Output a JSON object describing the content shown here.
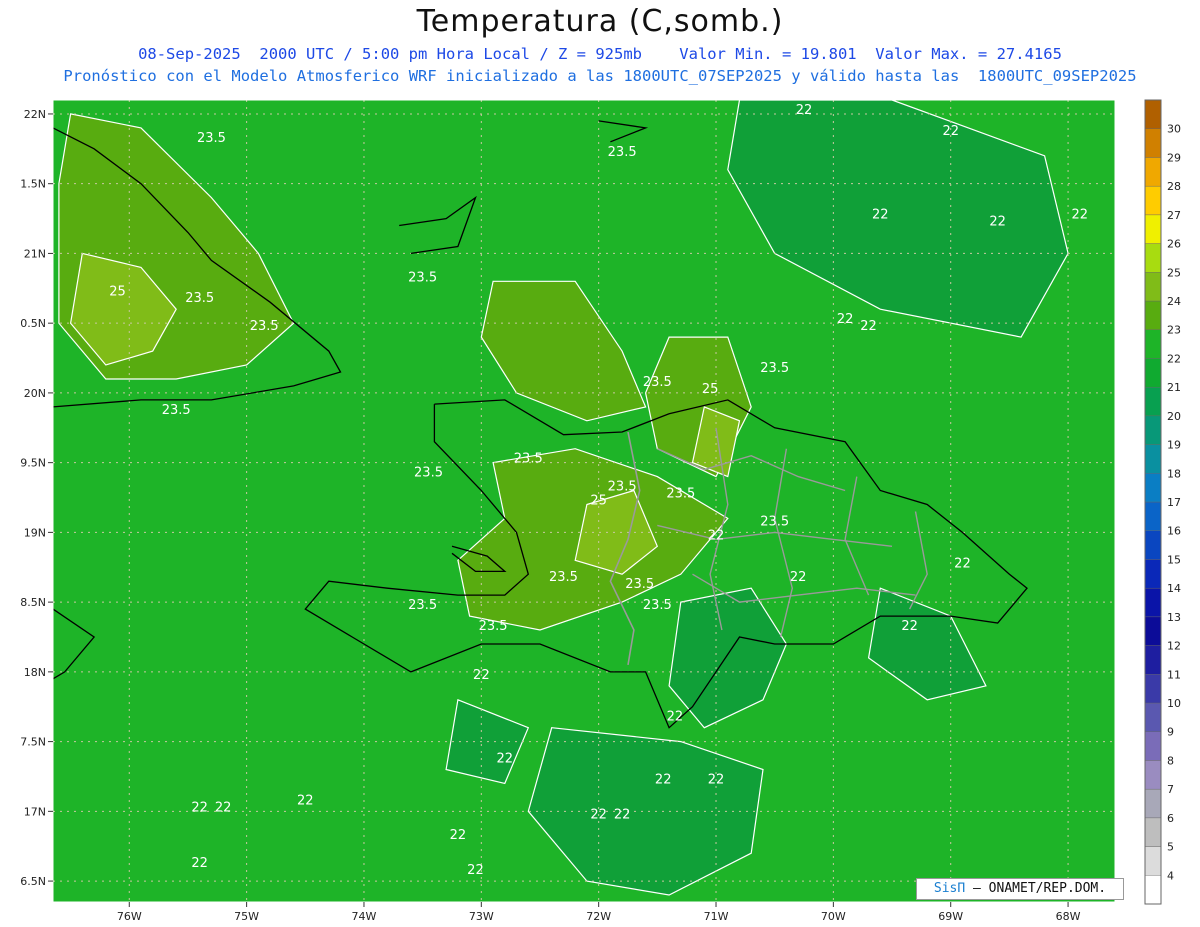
{
  "title": "Temperatura (C,somb.)",
  "subtitle_line1": "08-Sep-2025  2000 UTC / 5:00 pm Hora Local / Z = 925mb    Valor Min. = 19.801  Valor Max. = 27.4165",
  "subtitle_line2": "Pronóstico con el Modelo Atmosferico WRF inicializado a las 1800UTC_07SEP2025 y válido hasta las  1800UTC_09SEP2025",
  "credit": {
    "brand": "SisΠ",
    "text": " – ONAMET/REP.DOM."
  },
  "map": {
    "lon_range": [
      -76.65,
      -67.6
    ],
    "lat_range": [
      16.35,
      22.1
    ],
    "lat_ticks": [
      {
        "value": 22.0,
        "label": "22N"
      },
      {
        "value": 21.5,
        "label": "1.5N"
      },
      {
        "value": 21.0,
        "label": "21N"
      },
      {
        "value": 20.5,
        "label": "0.5N"
      },
      {
        "value": 20.0,
        "label": "20N"
      },
      {
        "value": 19.5,
        "label": "9.5N"
      },
      {
        "value": 19.0,
        "label": "19N"
      },
      {
        "value": 18.5,
        "label": "8.5N"
      },
      {
        "value": 18.0,
        "label": "18N"
      },
      {
        "value": 17.5,
        "label": "7.5N"
      },
      {
        "value": 17.0,
        "label": "17N"
      },
      {
        "value": 16.5,
        "label": "6.5N"
      }
    ],
    "lon_ticks": [
      {
        "value": -76,
        "label": "76W"
      },
      {
        "value": -75,
        "label": "75W"
      },
      {
        "value": -74,
        "label": "74W"
      },
      {
        "value": -73,
        "label": "73W"
      },
      {
        "value": -72,
        "label": "72W"
      },
      {
        "value": -71,
        "label": "71W"
      },
      {
        "value": -70,
        "label": "70W"
      },
      {
        "value": -69,
        "label": "69W"
      },
      {
        "value": -68,
        "label": "68W"
      }
    ],
    "base_color": "#1eb428",
    "colorbar": {
      "levels": [
        4,
        5,
        6,
        7,
        8,
        9,
        10,
        11,
        12,
        13,
        14,
        15,
        16,
        17,
        18,
        19,
        20,
        21,
        22,
        23,
        24,
        25,
        26,
        27,
        28,
        29,
        30
      ],
      "colors": [
        "#ffffff",
        "#dcdcdc",
        "#bebebe",
        "#a8a8b8",
        "#9a8cc0",
        "#7a6cb8",
        "#5a58b0",
        "#3a3aa8",
        "#1e1ea0",
        "#0c0c98",
        "#0a14a8",
        "#0a28b8",
        "#0a46c0",
        "#0a64c8",
        "#0a7ec4",
        "#0a90a0",
        "#089878",
        "#08a050",
        "#10aa30",
        "#1eb428",
        "#58ac10",
        "#80bc18",
        "#a8dc10",
        "#f0f000",
        "#ffcc00",
        "#f0a800",
        "#d08000",
        "#b06000"
      ]
    },
    "contour_labels": [
      "22",
      "23.5",
      "25"
    ],
    "regions": [
      {
        "level": "22",
        "color": "#10a038",
        "pts": [
          [
            -70.8,
            22.1
          ],
          [
            -69.5,
            22.1
          ],
          [
            -68.2,
            21.7
          ],
          [
            -68.0,
            21.0
          ],
          [
            -68.4,
            20.4
          ],
          [
            -69.6,
            20.6
          ],
          [
            -70.5,
            21.0
          ],
          [
            -70.9,
            21.6
          ]
        ]
      },
      {
        "level": "22",
        "color": "#10a038",
        "pts": [
          [
            -72.4,
            17.6
          ],
          [
            -71.3,
            17.5
          ],
          [
            -70.6,
            17.3
          ],
          [
            -70.7,
            16.7
          ],
          [
            -71.4,
            16.4
          ],
          [
            -72.1,
            16.5
          ],
          [
            -72.6,
            17.0
          ]
        ]
      },
      {
        "level": "22",
        "color": "#10a038",
        "pts": [
          [
            -71.3,
            18.5
          ],
          [
            -70.7,
            18.6
          ],
          [
            -70.4,
            18.2
          ],
          [
            -70.6,
            17.8
          ],
          [
            -71.1,
            17.6
          ],
          [
            -71.4,
            17.9
          ]
        ]
      },
      {
        "level": "22",
        "color": "#10a038",
        "pts": [
          [
            -73.2,
            17.8
          ],
          [
            -72.6,
            17.6
          ],
          [
            -72.8,
            17.2
          ],
          [
            -73.3,
            17.3
          ]
        ]
      },
      {
        "level": "22",
        "color": "#10a038",
        "pts": [
          [
            -69.6,
            18.6
          ],
          [
            -69.0,
            18.4
          ],
          [
            -68.7,
            17.9
          ],
          [
            -69.2,
            17.8
          ],
          [
            -69.7,
            18.1
          ]
        ]
      },
      {
        "level": "23.5",
        "color": "#58ac10",
        "pts": [
          [
            -76.5,
            22.0
          ],
          [
            -75.9,
            21.9
          ],
          [
            -75.3,
            21.4
          ],
          [
            -74.9,
            21.0
          ],
          [
            -74.6,
            20.5
          ],
          [
            -75.0,
            20.2
          ],
          [
            -75.6,
            20.1
          ],
          [
            -76.2,
            20.1
          ],
          [
            -76.6,
            20.5
          ],
          [
            -76.6,
            21.5
          ]
        ]
      },
      {
        "level": "23.5",
        "color": "#58ac10",
        "pts": [
          [
            -72.9,
            20.8
          ],
          [
            -72.2,
            20.8
          ],
          [
            -71.8,
            20.3
          ],
          [
            -71.6,
            19.9
          ],
          [
            -72.1,
            19.8
          ],
          [
            -72.7,
            20.0
          ],
          [
            -73.0,
            20.4
          ]
        ]
      },
      {
        "level": "23.5",
        "color": "#58ac10",
        "pts": [
          [
            -71.4,
            20.4
          ],
          [
            -70.9,
            20.4
          ],
          [
            -70.7,
            19.9
          ],
          [
            -71.0,
            19.4
          ],
          [
            -71.5,
            19.6
          ],
          [
            -71.6,
            20.0
          ]
        ]
      },
      {
        "level": "23.5",
        "color": "#58ac10",
        "pts": [
          [
            -72.9,
            19.5
          ],
          [
            -72.2,
            19.6
          ],
          [
            -71.5,
            19.4
          ],
          [
            -70.9,
            19.1
          ],
          [
            -71.3,
            18.7
          ],
          [
            -71.8,
            18.5
          ],
          [
            -72.5,
            18.3
          ],
          [
            -73.1,
            18.4
          ],
          [
            -73.2,
            18.8
          ],
          [
            -72.8,
            19.1
          ]
        ]
      },
      {
        "level": "25",
        "color": "#80bc18",
        "pts": [
          [
            -76.4,
            21.0
          ],
          [
            -75.9,
            20.9
          ],
          [
            -75.6,
            20.6
          ],
          [
            -75.8,
            20.3
          ],
          [
            -76.2,
            20.2
          ],
          [
            -76.5,
            20.5
          ]
        ]
      },
      {
        "level": "25",
        "color": "#80bc18",
        "pts": [
          [
            -72.1,
            19.2
          ],
          [
            -71.7,
            19.3
          ],
          [
            -71.5,
            18.9
          ],
          [
            -71.8,
            18.7
          ],
          [
            -72.2,
            18.8
          ]
        ]
      },
      {
        "level": "25",
        "color": "#80bc18",
        "pts": [
          [
            -71.1,
            19.9
          ],
          [
            -70.8,
            19.8
          ],
          [
            -70.9,
            19.4
          ],
          [
            -71.2,
            19.5
          ]
        ]
      }
    ],
    "coastlines": [
      {
        "name": "hispaniola",
        "pts": [
          [
            -73.4,
            19.92
          ],
          [
            -72.8,
            19.95
          ],
          [
            -72.3,
            19.7
          ],
          [
            -71.8,
            19.72
          ],
          [
            -71.4,
            19.85
          ],
          [
            -70.9,
            19.95
          ],
          [
            -70.5,
            19.75
          ],
          [
            -69.9,
            19.65
          ],
          [
            -69.6,
            19.3
          ],
          [
            -69.2,
            19.2
          ],
          [
            -68.9,
            19.0
          ],
          [
            -68.5,
            18.7
          ],
          [
            -68.35,
            18.6
          ],
          [
            -68.6,
            18.35
          ],
          [
            -69.0,
            18.4
          ],
          [
            -69.6,
            18.4
          ],
          [
            -70.0,
            18.2
          ],
          [
            -70.5,
            18.2
          ],
          [
            -70.8,
            18.25
          ],
          [
            -71.2,
            17.75
          ],
          [
            -71.4,
            17.6
          ],
          [
            -71.6,
            18.0
          ],
          [
            -71.9,
            18.0
          ],
          [
            -72.5,
            18.2
          ],
          [
            -73.0,
            18.2
          ],
          [
            -73.6,
            18.0
          ],
          [
            -74.1,
            18.25
          ],
          [
            -74.5,
            18.45
          ],
          [
            -74.3,
            18.65
          ],
          [
            -73.8,
            18.6
          ],
          [
            -73.2,
            18.55
          ],
          [
            -72.8,
            18.55
          ],
          [
            -72.6,
            18.7
          ],
          [
            -72.7,
            19.0
          ],
          [
            -73.0,
            19.3
          ],
          [
            -73.4,
            19.65
          ],
          [
            -73.4,
            19.92
          ]
        ]
      },
      {
        "name": "cuba",
        "pts": [
          [
            -76.65,
            21.9
          ],
          [
            -76.3,
            21.75
          ],
          [
            -75.9,
            21.5
          ],
          [
            -75.5,
            21.15
          ],
          [
            -75.3,
            20.95
          ],
          [
            -74.8,
            20.65
          ],
          [
            -74.3,
            20.3
          ],
          [
            -74.2,
            20.15
          ],
          [
            -74.6,
            20.05
          ],
          [
            -75.3,
            19.95
          ],
          [
            -75.9,
            19.95
          ],
          [
            -76.65,
            19.9
          ]
        ]
      },
      {
        "name": "gonave",
        "pts": [
          [
            -73.25,
            18.9
          ],
          [
            -72.95,
            18.83
          ],
          [
            -72.8,
            18.72
          ],
          [
            -73.05,
            18.72
          ],
          [
            -73.25,
            18.85
          ]
        ]
      },
      {
        "name": "great-inagua",
        "pts": [
          [
            -73.7,
            21.2
          ],
          [
            -73.3,
            21.25
          ],
          [
            -73.05,
            21.4
          ],
          [
            -73.2,
            21.05
          ],
          [
            -73.6,
            21.0
          ]
        ]
      },
      {
        "name": "turks-caicos",
        "pts": [
          [
            -72.0,
            21.95
          ],
          [
            -71.6,
            21.9
          ],
          [
            -71.9,
            21.8
          ]
        ]
      },
      {
        "name": "jamaica",
        "pts": [
          [
            -76.65,
            18.45
          ],
          [
            -76.3,
            18.25
          ],
          [
            -76.55,
            18.0
          ],
          [
            -76.65,
            17.95
          ]
        ]
      }
    ],
    "borders": [
      {
        "name": "haiti-dr",
        "pts": [
          [
            -71.75,
            19.72
          ],
          [
            -71.65,
            19.3
          ],
          [
            -71.75,
            18.95
          ],
          [
            -71.9,
            18.65
          ],
          [
            -71.7,
            18.3
          ],
          [
            -71.75,
            18.05
          ]
        ]
      }
    ],
    "provinces": [
      {
        "pts": [
          [
            -71.5,
            19.6
          ],
          [
            -71.1,
            19.45
          ],
          [
            -70.7,
            19.55
          ],
          [
            -70.3,
            19.4
          ],
          [
            -69.9,
            19.3
          ]
        ]
      },
      {
        "pts": [
          [
            -71.5,
            19.05
          ],
          [
            -71.0,
            18.95
          ],
          [
            -70.5,
            19.0
          ],
          [
            -70.0,
            18.95
          ],
          [
            -69.5,
            18.9
          ]
        ]
      },
      {
        "pts": [
          [
            -71.2,
            18.7
          ],
          [
            -70.8,
            18.5
          ],
          [
            -70.3,
            18.55
          ],
          [
            -69.8,
            18.6
          ],
          [
            -69.3,
            18.55
          ]
        ]
      },
      {
        "pts": [
          [
            -71.0,
            19.75
          ],
          [
            -70.9,
            19.2
          ],
          [
            -71.05,
            18.7
          ],
          [
            -70.95,
            18.3
          ]
        ]
      },
      {
        "pts": [
          [
            -70.4,
            19.6
          ],
          [
            -70.5,
            19.1
          ],
          [
            -70.35,
            18.6
          ],
          [
            -70.45,
            18.25
          ]
        ]
      },
      {
        "pts": [
          [
            -69.8,
            19.4
          ],
          [
            -69.9,
            18.95
          ],
          [
            -69.7,
            18.55
          ]
        ]
      },
      {
        "pts": [
          [
            -69.3,
            19.15
          ],
          [
            -69.2,
            18.7
          ],
          [
            -69.35,
            18.45
          ]
        ]
      }
    ],
    "contour_annotations": [
      {
        "text": "23.5",
        "lon": -75.3,
        "lat": 21.8
      },
      {
        "text": "23.5",
        "lon": -71.8,
        "lat": 21.7
      },
      {
        "text": "22",
        "lon": -70.25,
        "lat": 22.0
      },
      {
        "text": "22",
        "lon": -69.0,
        "lat": 21.85
      },
      {
        "text": "22",
        "lon": -69.6,
        "lat": 21.25
      },
      {
        "text": "22",
        "lon": -68.6,
        "lat": 21.2
      },
      {
        "text": "22",
        "lon": -67.9,
        "lat": 21.25
      },
      {
        "text": "22",
        "lon": -69.9,
        "lat": 20.5
      },
      {
        "text": "22",
        "lon": -69.7,
        "lat": 20.45
      },
      {
        "text": "25",
        "lon": -76.1,
        "lat": 20.7
      },
      {
        "text": "23.5",
        "lon": -75.4,
        "lat": 20.65
      },
      {
        "text": "23.5",
        "lon": -74.85,
        "lat": 20.45
      },
      {
        "text": "23.5",
        "lon": -73.5,
        "lat": 20.8
      },
      {
        "text": "23.5",
        "lon": -75.6,
        "lat": 19.85
      },
      {
        "text": "23.5",
        "lon": -71.5,
        "lat": 20.05
      },
      {
        "text": "25",
        "lon": -71.05,
        "lat": 20.0
      },
      {
        "text": "23.5",
        "lon": -70.5,
        "lat": 20.15
      },
      {
        "text": "23.5",
        "lon": -73.45,
        "lat": 19.4
      },
      {
        "text": "23.5",
        "lon": -72.6,
        "lat": 19.5
      },
      {
        "text": "25",
        "lon": -72.0,
        "lat": 19.2
      },
      {
        "text": "23.5",
        "lon": -71.8,
        "lat": 19.3
      },
      {
        "text": "23.5",
        "lon": -71.3,
        "lat": 19.25
      },
      {
        "text": "23.5",
        "lon": -70.5,
        "lat": 19.05
      },
      {
        "text": "22",
        "lon": -71.0,
        "lat": 18.95
      },
      {
        "text": "22",
        "lon": -70.3,
        "lat": 18.65
      },
      {
        "text": "22",
        "lon": -68.9,
        "lat": 18.75
      },
      {
        "text": "23.5",
        "lon": -72.3,
        "lat": 18.65
      },
      {
        "text": "23.5",
        "lon": -71.65,
        "lat": 18.6
      },
      {
        "text": "23.5",
        "lon": -73.5,
        "lat": 18.45
      },
      {
        "text": "23.5",
        "lon": -71.5,
        "lat": 18.45
      },
      {
        "text": "23.5",
        "lon": -72.9,
        "lat": 18.3
      },
      {
        "text": "22",
        "lon": -69.35,
        "lat": 18.3
      },
      {
        "text": "22",
        "lon": -73.0,
        "lat": 17.95
      },
      {
        "text": "22",
        "lon": -71.35,
        "lat": 17.65
      },
      {
        "text": "22",
        "lon": -72.8,
        "lat": 17.35
      },
      {
        "text": "22",
        "lon": -71.45,
        "lat": 17.2
      },
      {
        "text": "22",
        "lon": -71.0,
        "lat": 17.2
      },
      {
        "text": "22",
        "lon": -74.5,
        "lat": 17.05
      },
      {
        "text": "22",
        "lon": -75.4,
        "lat": 17.0
      },
      {
        "text": "22",
        "lon": -75.2,
        "lat": 17.0
      },
      {
        "text": "22",
        "lon": -72.0,
        "lat": 16.95
      },
      {
        "text": "22",
        "lon": -71.8,
        "lat": 16.95
      },
      {
        "text": "22",
        "lon": -73.2,
        "lat": 16.8
      },
      {
        "text": "22",
        "lon": -75.4,
        "lat": 16.6
      },
      {
        "text": "22",
        "lon": -73.05,
        "lat": 16.55
      }
    ]
  }
}
